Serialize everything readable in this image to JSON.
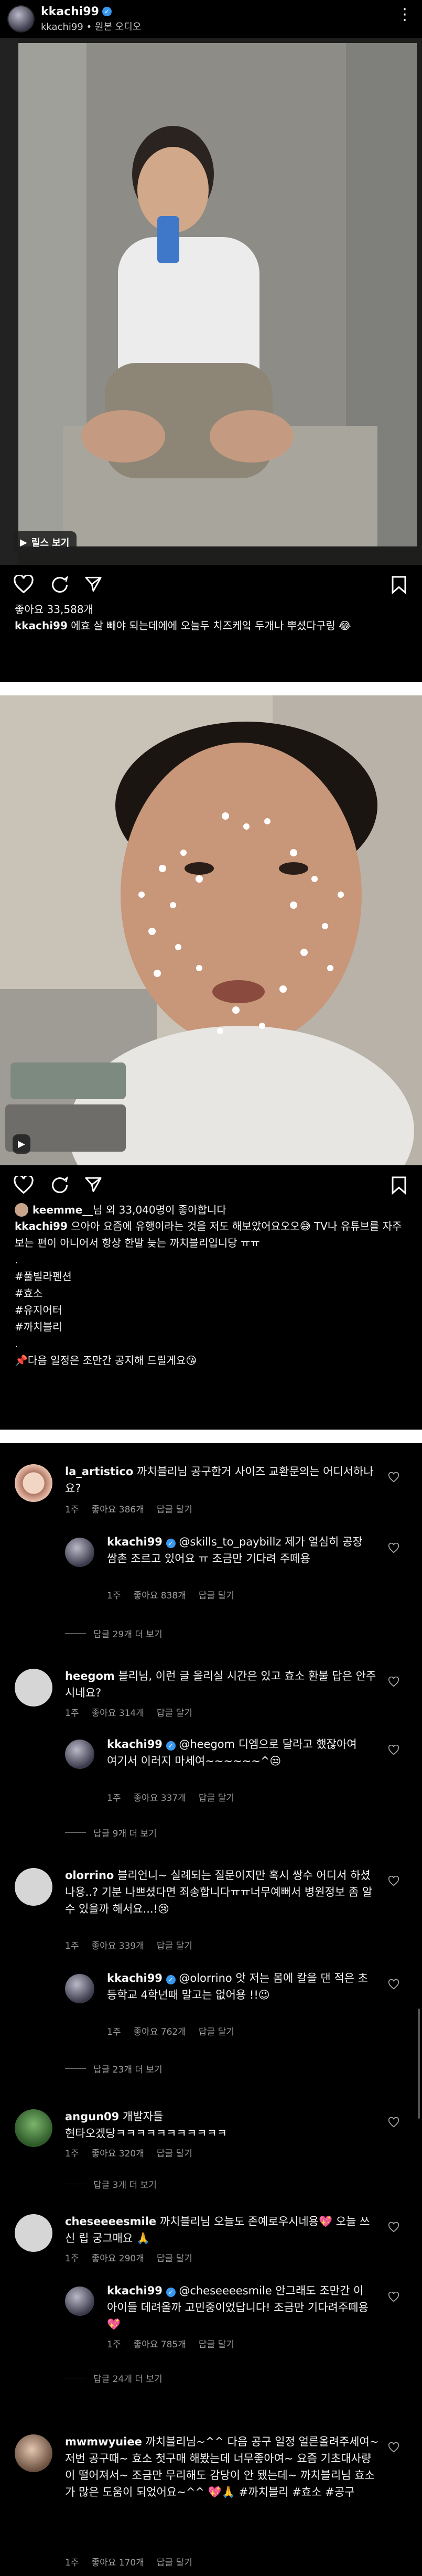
{
  "post1": {
    "username": "kkachi99",
    "subtitle": "kkachi99 • 원본 오디오",
    "reels_label": "릴스 보기",
    "likes": "좋아요 33,588개",
    "caption_user": "kkachi99",
    "caption_text": "에효 살 빼야 되는데에에 오늘두 치즈케잌 두개나 뿌셨다구링 😂"
  },
  "post2": {
    "liked_by_user": "keemme__",
    "liked_by_text": "님 외 33,040명이 좋아합니다",
    "caption_user": "kkachi99",
    "caption_text": "으아아 요즘에 유행이라는 것을 저도 해보았어요오오😅 TV나 유튜브를 자주 보는 편이 아니어서 항상 한발 늦는 까치블리입니당 ㅠㅠ",
    "hashtags": [
      "#풀빌라펜션",
      "#효소",
      "#유지어터",
      "#까치블리"
    ],
    "dot": ".",
    "footer": "다음 일정은 조만간 공지해 드릴게요😘"
  },
  "comments": [
    {
      "user": "la_artistico",
      "text": "까치블리님 공구한거 사이즈 교환문의는 어디서하나요?",
      "time": "1주",
      "likes": "좋아요 386개",
      "reply": "답글 달기",
      "reply_user": "kkachi99",
      "reply_text": "@skills_to_paybillz 제가 열심히 공장쌈촌 조르고 있어요 ㅠ 조금만 기다려 주떼용",
      "reply_likes": "좋아요 838개",
      "more": "답글 29개 더 보기"
    },
    {
      "user": "heegom",
      "text": "블리님, 이런 글 올리실 시간은 있고 효소 환불 답은 안주시네요?",
      "time": "1주",
      "likes": "좋아요 314개",
      "reply": "답글 달기",
      "reply_user": "kkachi99",
      "reply_text": "@heegom 디엠으로 달라고 했잖아여 여기서 이러지 마세여~~~~~~^😒",
      "reply_likes": "좋아요 337개",
      "more": "답글 9개 더 보기"
    },
    {
      "user": "olorrino",
      "text": "블리언니~ 실례되는 질문이지만 혹시 쌍수 어디서 하셨나용..? 기분 나쁘셨다면 죄송합니다ㅠㅠ너무예뻐서 병원정보 좀 알 수 있을까 해서요...!😢",
      "time": "1주",
      "likes": "좋아요 339개",
      "reply": "답글 달기",
      "reply_user": "kkachi99",
      "reply_text": "@olorrino 앗 저는 몸에 칼을 댄 적은 초등학교 4학년때 말고는 없어용 !!😉",
      "reply_likes": "좋아요 762개",
      "more": "답글 23개 더 보기"
    },
    {
      "user": "angun09",
      "user_suffix": "개발자들",
      "text": "현타오겠당ㅋㅋㅋㅋㅋㅋㅋㅋㅋㅋㅋ",
      "time": "1주",
      "likes": "좋아요 320개",
      "reply": "답글 달기",
      "more": "답글 3개 더 보기"
    },
    {
      "user": "cheseeeesmile",
      "text": "까치블리님 오늘도 존예로우시네용💖 오늘 쓰신 립 궁그매요 🙏",
      "time": "1주",
      "likes": "좋아요 290개",
      "reply": "답글 달기",
      "reply_user": "kkachi99",
      "reply_text": "@cheseeeesmile 안그래도 조만간 이 아이들 데려올까 고민중이었답니다! 조금만 기다려주떼용💖",
      "reply_likes": "좋아요 785개",
      "more": "답글 24개 더 보기"
    },
    {
      "user": "mwmwyuiee",
      "text": "까치블리님~^^ 다음 공구 일정 얼른올려주세여~ 저번 공구때~ 효소 첫구매 해봤는데 너무좋아여~ 요즘 기초대사량이 떨어져서~ 조금만 무리해도 감당이 안 됐는데~ 까치블리님 효소가 많은 도움이 되었어요~^^ 💖🙏 #까치블리 #효소 #공구",
      "time": "1주",
      "likes": "좋아요 170개",
      "reply": "답글 달기"
    }
  ]
}
